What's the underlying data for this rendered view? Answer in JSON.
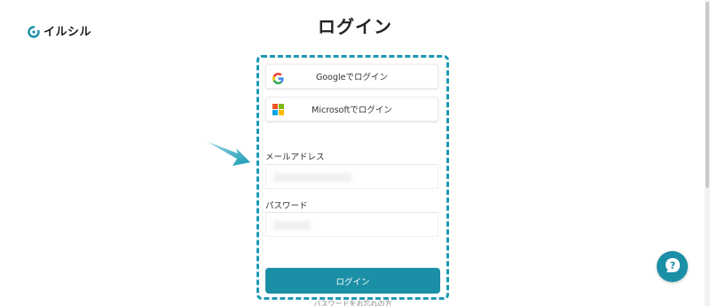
{
  "brand": {
    "name": "イルシル",
    "logo_icon": "ilsil-logo-icon"
  },
  "page": {
    "title": "ログイン"
  },
  "login_form": {
    "google_button": {
      "label": "Googleでログイン",
      "icon": "google-icon"
    },
    "microsoft_button": {
      "label": "Microsoftでログイン",
      "icon": "microsoft-icon"
    },
    "email": {
      "label": "メールアドレス",
      "value": ""
    },
    "password": {
      "label": "パスワード",
      "value": ""
    },
    "submit_label": "ログイン",
    "forgot_password_label": "パスワードをお忘れの方"
  },
  "help_widget": {
    "icon": "question-icon"
  },
  "colors": {
    "accent": "#1b8fa6",
    "highlight_border": "#1b9ab3",
    "google_blue": "#4285F4",
    "google_red": "#EA4335",
    "google_yellow": "#FBBC05",
    "google_green": "#34A853",
    "ms_red": "#F25022",
    "ms_green": "#7FBA00",
    "ms_blue": "#00A4EF",
    "ms_yellow": "#FFB900"
  }
}
